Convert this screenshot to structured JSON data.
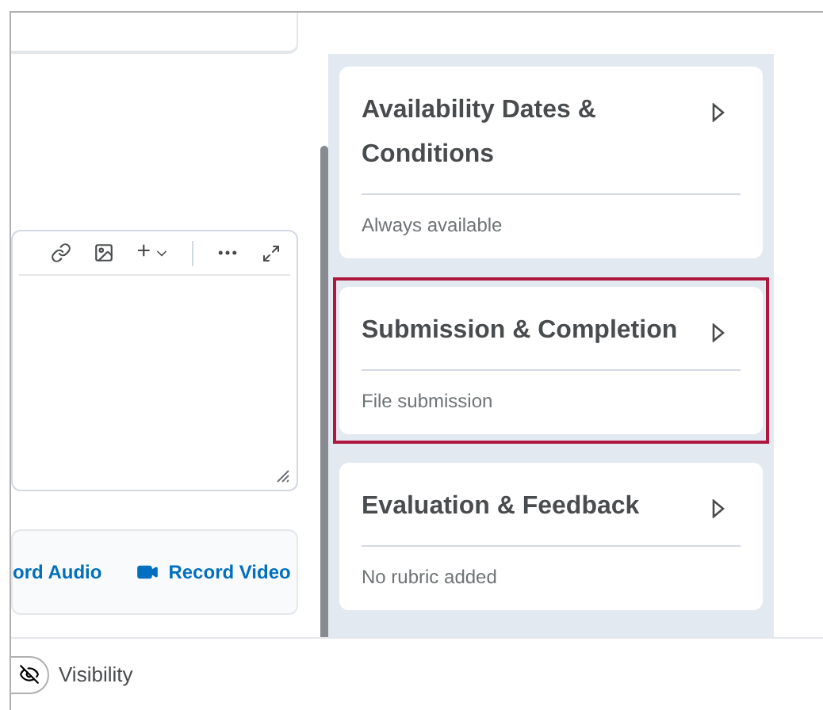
{
  "editor_toolbar": {
    "insert_menu": "+"
  },
  "recording": [
    {
      "label": "ord Audio",
      "kind": "audio"
    },
    {
      "label": "Record Video",
      "kind": "video"
    }
  ],
  "panels": [
    {
      "title": "Availability Dates & Conditions",
      "summary": "Always available",
      "highlighted": false
    },
    {
      "title": "Submission & Completion",
      "summary": "File submission",
      "highlighted": true
    },
    {
      "title": "Evaluation & Feedback",
      "summary": "No rubric added",
      "highlighted": false
    }
  ],
  "footer": {
    "visibility_label": "Visibility"
  }
}
